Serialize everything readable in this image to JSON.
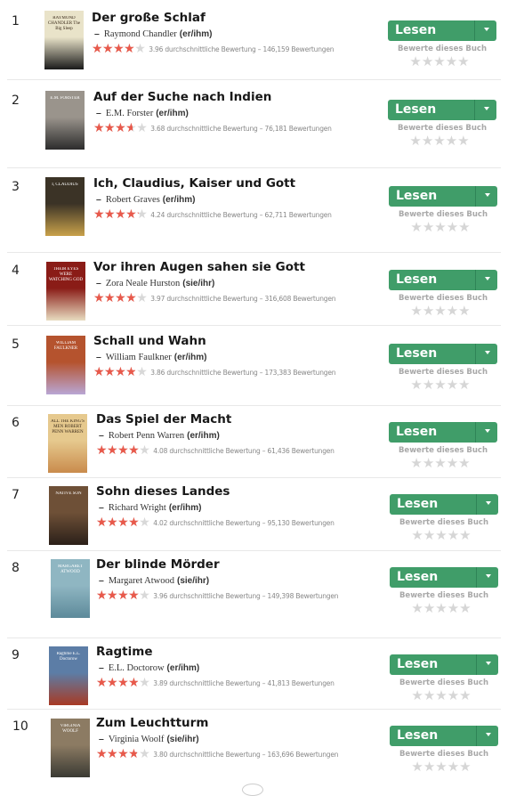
{
  "books": [
    {
      "rank": "1",
      "title": "Der große Schlaf",
      "author": "Raymond Chandler",
      "pronoun": "(er/ihm)",
      "avg": 3.96,
      "rating_text": "3.96 durchschnittliche Bewertung – 146,159 Bewertungen",
      "cover_text": "RAYMOND CHANDLER The Big Sleep",
      "cover_colors": [
        "#e9e3c9",
        "#1a1a1a"
      ]
    },
    {
      "rank": "2",
      "title": "Auf der Suche nach Indien",
      "author": "E.M. Forster",
      "pronoun": "(er/ihm)",
      "avg": 3.68,
      "rating_text": "3.68 durchschnittliche Bewertung – 76,181 Bewertungen",
      "cover_text": "E.M. FORSTER",
      "cover_colors": [
        "#9a948c",
        "#2c2c2c"
      ]
    },
    {
      "rank": "3",
      "title": "Ich, Claudius, Kaiser und Gott",
      "author": "Robert Graves",
      "pronoun": "(er/ihm)",
      "avg": 4.24,
      "rating_text": "4.24 durchschnittliche Bewertung – 62,711 Bewertungen",
      "cover_text": "I, CLAUDIUS",
      "cover_colors": [
        "#3b3326",
        "#c9a24a"
      ]
    },
    {
      "rank": "4",
      "title": "Vor ihren Augen sahen sie Gott",
      "author": "Zora Neale Hurston",
      "pronoun": "(sie/ihr)",
      "avg": 3.97,
      "rating_text": "3.97 durchschnittliche Bewertung – 316,608 Bewertungen",
      "cover_text": "THEIR EYES WERE WATCHING GOD",
      "cover_colors": [
        "#8a1c17",
        "#e8dcc0"
      ]
    },
    {
      "rank": "5",
      "title": "Schall und Wahn",
      "author": "William Faulkner",
      "pronoun": "(er/ihm)",
      "avg": 3.86,
      "rating_text": "3.86 durchschnittliche Bewertung – 173,383 Bewertungen",
      "cover_text": "WILLIAM FAULKNER",
      "cover_colors": [
        "#b5532e",
        "#b9a6d4"
      ]
    },
    {
      "rank": "6",
      "title": "Das Spiel der Macht",
      "author": "Robert Penn Warren",
      "pronoun": "(er/ihm)",
      "avg": 4.08,
      "rating_text": "4.08 durchschnittliche Bewertung – 61,436 Bewertungen",
      "cover_text": "ALL THE KING'S MEN ROBERT PENN WARREN",
      "cover_colors": [
        "#e6c98e",
        "#c98b4c"
      ]
    },
    {
      "rank": "7",
      "title": "Sohn dieses Landes",
      "author": "Richard Wright",
      "pronoun": "(er/ihm)",
      "avg": 4.02,
      "rating_text": "4.02 durchschnittliche Bewertung – 95,130 Bewertungen",
      "cover_text": "NATIVE SON",
      "cover_colors": [
        "#6e5037",
        "#2b2019"
      ]
    },
    {
      "rank": "8",
      "title": "Der blinde Mörder",
      "author": "Margaret Atwood",
      "pronoun": "(sie/ihr)",
      "avg": 3.96,
      "rating_text": "3.96 durchschnittliche Bewertung – 149,398 Bewertungen",
      "cover_text": "MARGARET ATWOOD",
      "cover_colors": [
        "#8fb6c2",
        "#5d8a9a"
      ]
    },
    {
      "rank": "9",
      "title": "Ragtime",
      "author": "E.L. Doctorow",
      "pronoun": "(er/ihm)",
      "avg": 3.89,
      "rating_text": "3.89 durchschnittliche Bewertung – 41,813 Bewertungen",
      "cover_text": "Ragtime E.L. Doctorow",
      "cover_colors": [
        "#5c7da6",
        "#a83a24"
      ]
    },
    {
      "rank": "10",
      "title": "Zum Leuchtturm",
      "author": "Virginia Woolf",
      "pronoun": "(sie/ihr)",
      "avg": 3.8,
      "rating_text": "3.80 durchschnittliche Bewertung – 163,696 Bewertungen",
      "cover_text": "VIRGINIA WOOLF",
      "cover_colors": [
        "#8c7b63",
        "#3a3a33"
      ]
    }
  ],
  "button_label": "Lesen",
  "rate_label": "Bewerte dieses Buch",
  "accent_green": "#409d69",
  "star_red": "#e8594b",
  "icons": {
    "dropdown": "caret-down-icon",
    "star": "star-icon"
  }
}
